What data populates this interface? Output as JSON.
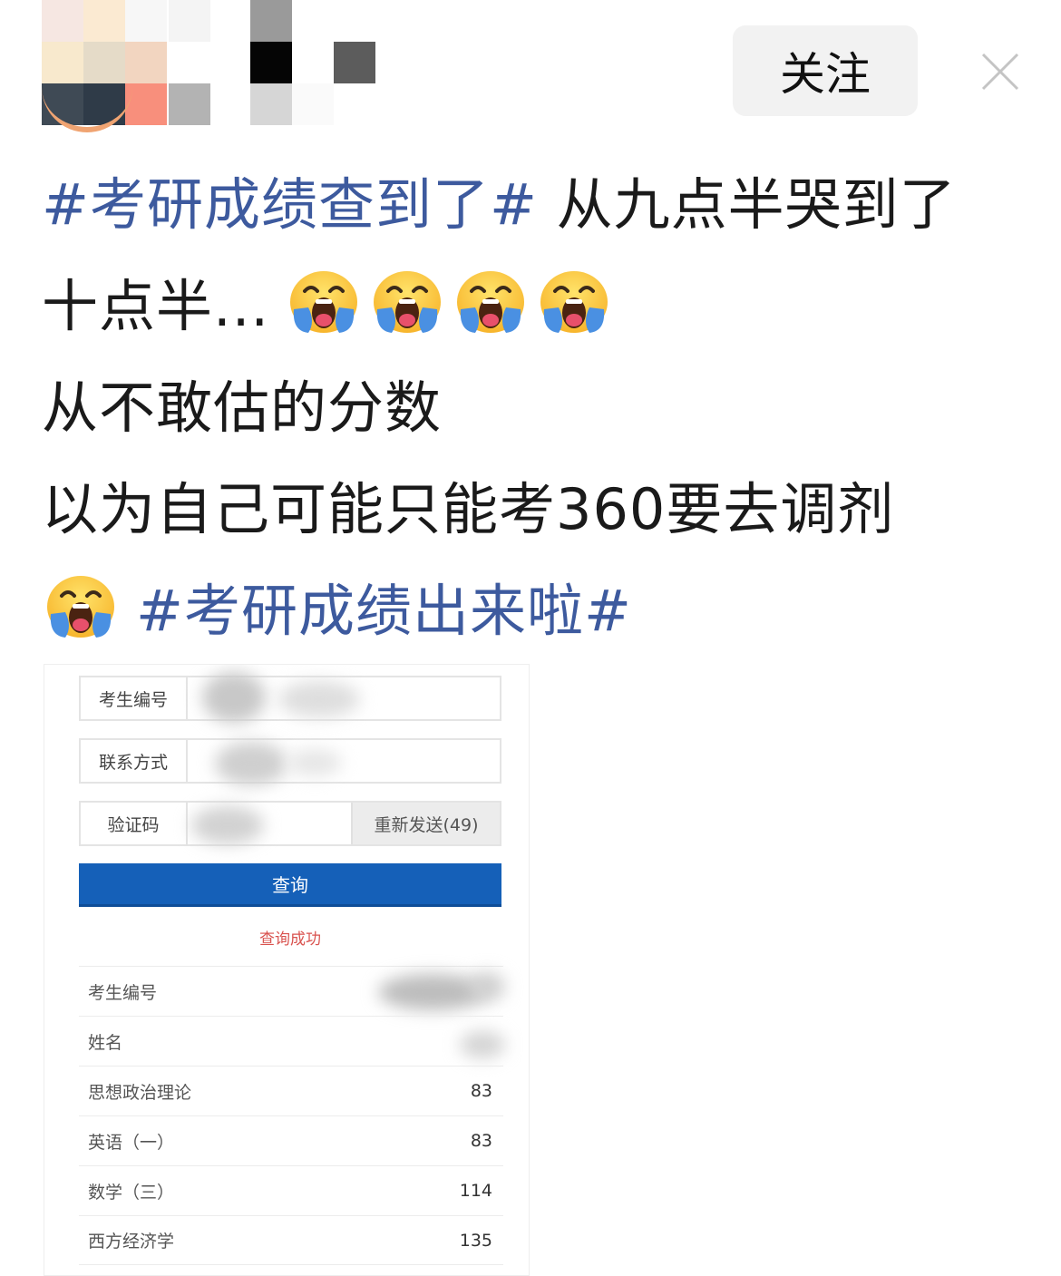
{
  "header": {
    "follow_label": "关注",
    "close_icon": "close-icon"
  },
  "post": {
    "line1_hashtag": "#考研成绩查到了#",
    "line1_text": " 从九点半哭到了",
    "line2_text": "十点半...",
    "line3_text": "从不敢估的分数",
    "line4_text": "以为自己可能只能考360要去调剂",
    "line5_hashtag": "#考研成绩出来啦#",
    "emoji_name": "loudly-crying-face-emoji",
    "hashtag_color": "#3d5a9e"
  },
  "screenshot": {
    "form": {
      "exam_id_label": "考生编号",
      "contact_label": "联系方式",
      "captcha_label": "验证码",
      "resend_label": "重新发送(49)"
    },
    "query_button": "查询",
    "query_success": "查询成功",
    "results": [
      {
        "label": "考生编号",
        "value": ""
      },
      {
        "label": "姓名",
        "value": ""
      },
      {
        "label": "思想政治理论",
        "value": "83"
      },
      {
        "label": "英语（一）",
        "value": "83"
      },
      {
        "label": "数学（三）",
        "value": "114"
      },
      {
        "label": "西方经济学",
        "value": "135"
      }
    ],
    "button_color": "#1560b8",
    "success_color": "#d9534f"
  }
}
